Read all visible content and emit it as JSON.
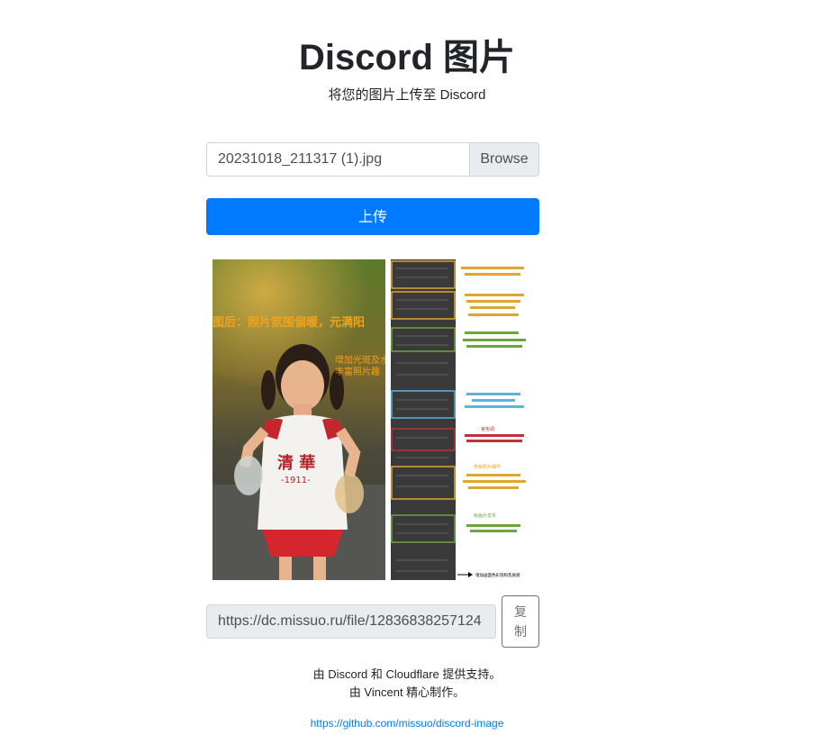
{
  "header": {
    "title": "Discord 图片",
    "subtitle": "将您的图片上传至 Discord"
  },
  "file_input": {
    "filename": "20231018_211317 (1).jpg",
    "browse_label": "Browse"
  },
  "upload_button": {
    "label": "上传"
  },
  "preview": {
    "left_caption_1": "图后：照片氛围偏暖，元满阳",
    "left_caption_2": "增加光斑及水",
    "left_caption_3": "丰富照片趣",
    "shirt_text_1": "清 華",
    "shirt_text_2": "-1911-",
    "notes": [
      "官色调",
      "恢复照片细节",
      "绘画片去灰"
    ],
    "arrow_note": "增加画面色彩饱和及质感"
  },
  "result": {
    "url": "https://dc.missuo.ru/file/12836838257124",
    "copy_label": "复制"
  },
  "footer": {
    "line1": "由 Discord 和 Cloudflare 提供支持。",
    "line2": "由 Vincent 精心制作。",
    "link_text": "https://github.com/missuo/discord-image"
  },
  "colors": {
    "primary": "#007bff",
    "text": "#212529",
    "muted": "#6c757d",
    "input_border": "#ced4da",
    "readonly_bg": "#e9ecef"
  }
}
